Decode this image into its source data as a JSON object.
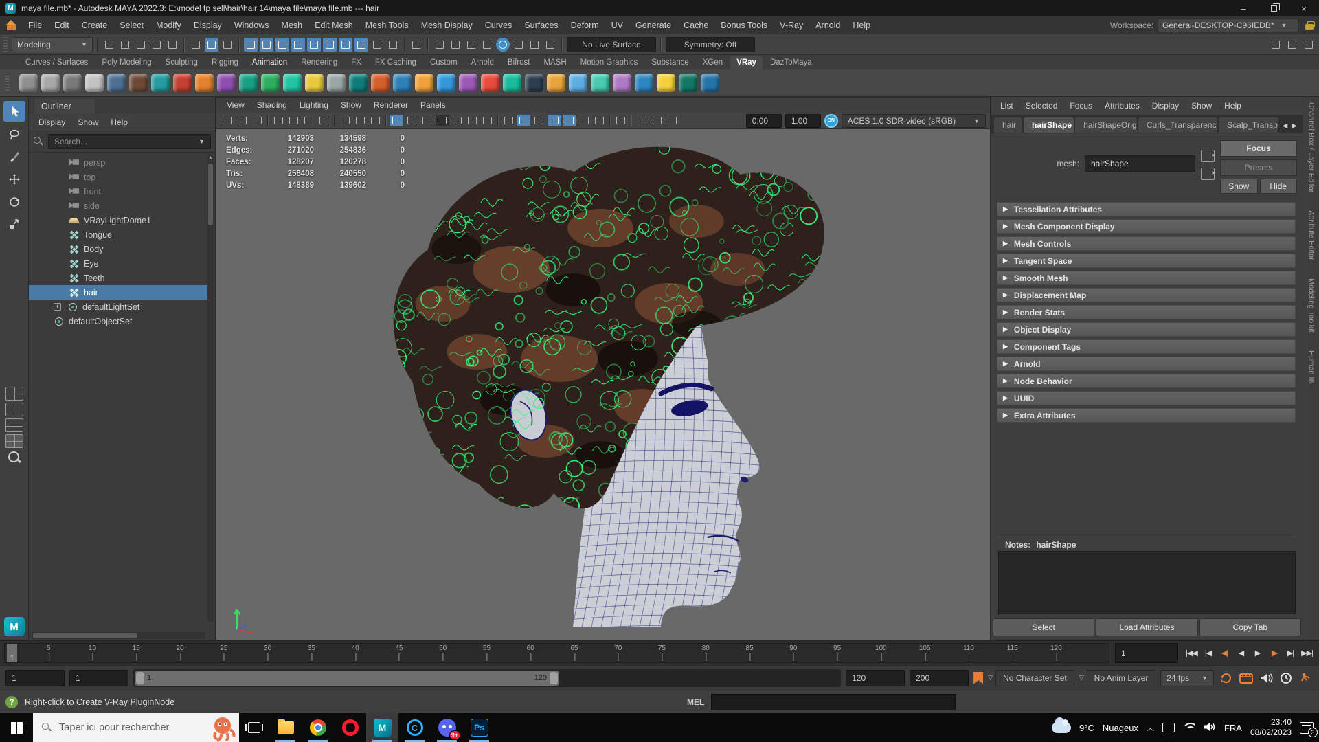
{
  "title_bar": {
    "title": "maya file.mb* - Autodesk MAYA 2022.3: E:\\model tp sell\\hair\\hair 14\\maya file\\maya file.mb   ---   hair",
    "minimize": "–",
    "close": "×",
    "app_initial": "M"
  },
  "menu_bar": {
    "items": [
      "File",
      "Edit",
      "Create",
      "Select",
      "Modify",
      "Display",
      "Windows",
      "Mesh",
      "Edit Mesh",
      "Mesh Tools",
      "Mesh Display",
      "Curves",
      "Surfaces",
      "Deform",
      "UV",
      "Generate",
      "Cache",
      "Bonus Tools",
      "V-Ray",
      "Arnold",
      "Help"
    ],
    "workspace_label": "Workspace:",
    "workspace_value": "General-DESKTOP-C96IEDB*"
  },
  "status_line": {
    "mode": "Modeling",
    "live_surface": "No Live Surface",
    "symmetry": "Symmetry: Off",
    "icons": [
      {
        "name": "new-scene-icon"
      },
      {
        "name": "open-scene-icon"
      },
      {
        "name": "save-scene-icon"
      },
      {
        "name": "undo-icon"
      },
      {
        "name": "redo-icon"
      },
      {
        "name": "sep",
        "cls": "sep"
      },
      {
        "name": "select-hierarchy-icon"
      },
      {
        "name": "select-object-icon",
        "state": "on"
      },
      {
        "name": "select-component-icon"
      },
      {
        "name": "sep",
        "cls": "sep"
      },
      {
        "name": "snap-grid-icon",
        "state": "on"
      },
      {
        "name": "snap-curve-icon",
        "state": "on"
      },
      {
        "name": "snap-point-icon",
        "state": "on"
      },
      {
        "name": "snap-projected-center-icon",
        "state": "on"
      },
      {
        "name": "snap-view-plane-icon",
        "state": "on"
      },
      {
        "name": "make-live-icon",
        "state": "on"
      },
      {
        "name": "snap-together-icon",
        "state": "on"
      },
      {
        "name": "snap-magnet-icon",
        "state": "on"
      },
      {
        "name": "lock-selection-icon"
      },
      {
        "name": "highlight-selection-icon"
      },
      {
        "name": "sep",
        "cls": "sep"
      },
      {
        "name": "construction-history-icon"
      },
      {
        "name": "sep",
        "cls": "sep"
      },
      {
        "name": "render-icon"
      },
      {
        "name": "ipr-render-icon"
      },
      {
        "name": "render-settings-icon"
      },
      {
        "name": "light-editor-icon"
      },
      {
        "name": "collaborate-icon",
        "state": "blue-round"
      },
      {
        "name": "render-sequence-icon"
      },
      {
        "name": "scene-checkup-icon"
      },
      {
        "name": "pause-viewport-icon"
      }
    ]
  },
  "shelf": {
    "tabs": [
      {
        "label": "Curves / Surfaces"
      },
      {
        "label": "Poly Modeling"
      },
      {
        "label": "Sculpting"
      },
      {
        "label": "Rigging"
      },
      {
        "label": "Animation",
        "cls": "bright"
      },
      {
        "label": "Rendering"
      },
      {
        "label": "FX"
      },
      {
        "label": "FX Caching"
      },
      {
        "label": "Custom"
      },
      {
        "label": "Arnold"
      },
      {
        "label": "Bifrost"
      },
      {
        "label": "MASH"
      },
      {
        "label": "Motion Graphics"
      },
      {
        "label": "Substance"
      },
      {
        "label": "XGen"
      },
      {
        "label": "VRay",
        "cls": "active"
      },
      {
        "label": "DazToMaya"
      }
    ],
    "icon_colors": [
      {
        "color": "#8f8f8f"
      },
      {
        "color": "#a8a8a8"
      },
      {
        "color": "#7a7a7a"
      },
      {
        "color": "#c2c2c2"
      },
      {
        "color": "#4d6f94"
      },
      {
        "color": "#6e4a36"
      },
      {
        "color": "#269ba0"
      },
      {
        "color": "#c44030"
      },
      {
        "color": "#e2812f"
      },
      {
        "color": "#8e4fae"
      },
      {
        "color": "#18a085"
      },
      {
        "color": "#2fae60"
      },
      {
        "color": "#22c4a2"
      },
      {
        "color": "#e8c83f"
      },
      {
        "color": "#9aa5a6"
      },
      {
        "color": "#0f7c7b"
      },
      {
        "color": "#d35f2a"
      },
      {
        "color": "#2f80b9"
      },
      {
        "color": "#f0a03c"
      },
      {
        "color": "#3498db"
      },
      {
        "color": "#9b59b6"
      },
      {
        "color": "#e74c3c"
      },
      {
        "color": "#1abc9c"
      },
      {
        "color": "#2c3e50"
      },
      {
        "color": "#e8a33d"
      },
      {
        "color": "#5dade2"
      },
      {
        "color": "#48c9b0"
      },
      {
        "color": "#af7ac5"
      },
      {
        "color": "#2e86c1"
      },
      {
        "color": "#f4d03f"
      },
      {
        "color": "#117864"
      },
      {
        "color": "#2574a9"
      }
    ]
  },
  "outliner": {
    "title": "Outliner",
    "menus": [
      "Display",
      "Show",
      "Help"
    ],
    "search_placeholder": "Search...",
    "items": [
      {
        "label": "persp",
        "icon": "camera",
        "muted": true
      },
      {
        "label": "top",
        "icon": "camera",
        "muted": true
      },
      {
        "label": "front",
        "icon": "camera",
        "muted": true
      },
      {
        "label": "side",
        "icon": "camera",
        "muted": true
      },
      {
        "label": "VRayLightDome1",
        "icon": "dome-light"
      },
      {
        "label": "Tongue",
        "icon": "mesh"
      },
      {
        "label": "Body",
        "icon": "mesh"
      },
      {
        "label": "Eye",
        "icon": "mesh"
      },
      {
        "label": "Teeth",
        "icon": "mesh"
      },
      {
        "label": "hair",
        "icon": "mesh",
        "selected": true
      },
      {
        "label": "defaultLightSet",
        "icon": "set",
        "cls": "set expandable",
        "expander": "+"
      },
      {
        "label": "defaultObjectSet",
        "icon": "set",
        "cls": "set"
      }
    ]
  },
  "viewport": {
    "menus": [
      "View",
      "Shading",
      "Lighting",
      "Show",
      "Renderer",
      "Panels"
    ],
    "toolbar_icons": [
      {
        "name": "renderer-toggle-icon"
      },
      {
        "name": "ghost-unselected-icon"
      },
      {
        "name": "ghost-other-icon"
      },
      {
        "name": "sep",
        "cls": "sep"
      },
      {
        "name": "select-camera-icon"
      },
      {
        "name": "lock-camera-icon"
      },
      {
        "name": "camera-attributes-icon"
      },
      {
        "name": "bookmark-icon"
      },
      {
        "name": "sep",
        "cls": "sep"
      },
      {
        "name": "grease-pencil-icon"
      },
      {
        "name": "zoom-select-icon"
      },
      {
        "name": "paint-effects-icon"
      },
      {
        "name": "sep",
        "cls": "sep"
      },
      {
        "name": "grid-icon",
        "state": "on"
      },
      {
        "name": "film-gate-icon"
      },
      {
        "name": "resolution-gate-icon"
      },
      {
        "name": "gate-mask-icon",
        "state": "pressed"
      },
      {
        "name": "field-chart-icon"
      },
      {
        "name": "image-plane-icon"
      },
      {
        "name": "hud-text-icon"
      },
      {
        "name": "sep",
        "cls": "sep"
      },
      {
        "name": "wireframe-icon"
      },
      {
        "name": "shaded-icon",
        "state": "on"
      },
      {
        "name": "textured-icon"
      },
      {
        "name": "wireframe-on-shaded-icon",
        "state": "on"
      },
      {
        "name": "checker-icon",
        "state": "on"
      },
      {
        "name": "lights-icon"
      },
      {
        "name": "shadows-icon"
      },
      {
        "name": "sep",
        "cls": "sep"
      },
      {
        "name": "isolate-select-icon"
      },
      {
        "name": "sep",
        "cls": "sep"
      },
      {
        "name": "copy-view-icon"
      },
      {
        "name": "paste-view-icon"
      },
      {
        "name": "crop-view-icon"
      }
    ],
    "exposure": "0.00",
    "gamma": "1.00",
    "on_label": "ON",
    "color_space": "ACES 1.0 SDR-video (sRGB)",
    "hud": {
      "rows": [
        {
          "label": "Verts:",
          "a": "142903",
          "b": "134598",
          "c": "0"
        },
        {
          "label": "Edges:",
          "a": "271020",
          "b": "254836",
          "c": "0"
        },
        {
          "label": "Faces:",
          "a": "128207",
          "b": "120278",
          "c": "0"
        },
        {
          "label": "Tris:",
          "a": "256408",
          "b": "240550",
          "c": "0"
        },
        {
          "label": "UVs:",
          "a": "148389",
          "b": "139602",
          "c": "0"
        }
      ]
    }
  },
  "attribute_editor": {
    "menus": [
      "List",
      "Selected",
      "Focus",
      "Attributes",
      "Display",
      "Show",
      "Help"
    ],
    "tabs": [
      {
        "label": "hair"
      },
      {
        "label": "hairShape",
        "cls": "active"
      },
      {
        "label": "hairShapeOrig"
      },
      {
        "label": "Curls_Transparency"
      },
      {
        "label": "Scalp_Transp"
      }
    ],
    "tab_prev": "◀",
    "tab_next": "▶",
    "mesh_label": "mesh:",
    "mesh_value": "hairShape",
    "focus_label": "Focus",
    "presets_label": "Presets",
    "show_label": "Show",
    "hide_label": "Hide",
    "sections": [
      "Tessellation Attributes",
      "Mesh Component Display",
      "Mesh Controls",
      "Tangent Space",
      "Smooth Mesh",
      "Displacement Map",
      "Render Stats",
      "Object Display",
      "Component Tags",
      "Arnold",
      "Node Behavior",
      "UUID",
      "Extra Attributes"
    ],
    "notes_label": "Notes:",
    "notes_value": "hairShape",
    "footer_buttons": [
      "Select",
      "Load Attributes",
      "Copy Tab"
    ]
  },
  "side_tabs": [
    "Channel Box / Layer Editor",
    "Attribute Editor",
    "Modeling Toolkit",
    "Human IK"
  ],
  "timeline": {
    "ticks": [
      "5",
      "10",
      "15",
      "20",
      "25",
      "30",
      "35",
      "40",
      "45",
      "50",
      "55",
      "60",
      "65",
      "70",
      "75",
      "80",
      "85",
      "90",
      "95",
      "100",
      "105",
      "110",
      "115",
      "120"
    ],
    "playhead": "1",
    "current_frame": "1",
    "buttons": [
      {
        "name": "go-to-start-button",
        "glyph": "|◀◀"
      },
      {
        "name": "step-back-frame-button",
        "glyph": "|◀"
      },
      {
        "name": "step-back-key-button",
        "glyph": "◀|",
        "cls": "accent"
      },
      {
        "name": "play-backwards-button",
        "glyph": "◀"
      },
      {
        "name": "play-forwards-button",
        "glyph": "▶"
      },
      {
        "name": "step-forward-key-button",
        "glyph": "|▶",
        "cls": "accent"
      },
      {
        "name": "step-forward-frame-button",
        "glyph": "▶|"
      },
      {
        "name": "go-to-end-button",
        "glyph": "▶▶|"
      }
    ]
  },
  "range_slider": {
    "anim_start": "1",
    "play_start": "1",
    "bar_start": "1",
    "bar_end": "120",
    "play_end": "120",
    "anim_end": "200",
    "character_set": "No Character Set",
    "anim_layer": "No Anim Layer",
    "fps": "24 fps"
  },
  "help_line": {
    "message": "Right-click to Create V-Ray PluginNode",
    "mel_label": "MEL"
  },
  "taskbar": {
    "search_placeholder": "Taper ici pour rechercher",
    "opera_label": "O",
    "maya_label": "M",
    "c_label": "C",
    "ps_label": "Ps",
    "discord_badge": "9+",
    "weather_temp": "9°C",
    "weather_desc": "Nuageux",
    "language": "FRA",
    "time": "23:40",
    "date": "08/02/2023",
    "notification_count": "3"
  },
  "colors": {
    "active_blue": "#4f86ba",
    "selection_blue": "#4a7ba6",
    "hair_green": "#36f47c",
    "wire_navy": "#23237c",
    "accent_orange": "#e2813a"
  }
}
